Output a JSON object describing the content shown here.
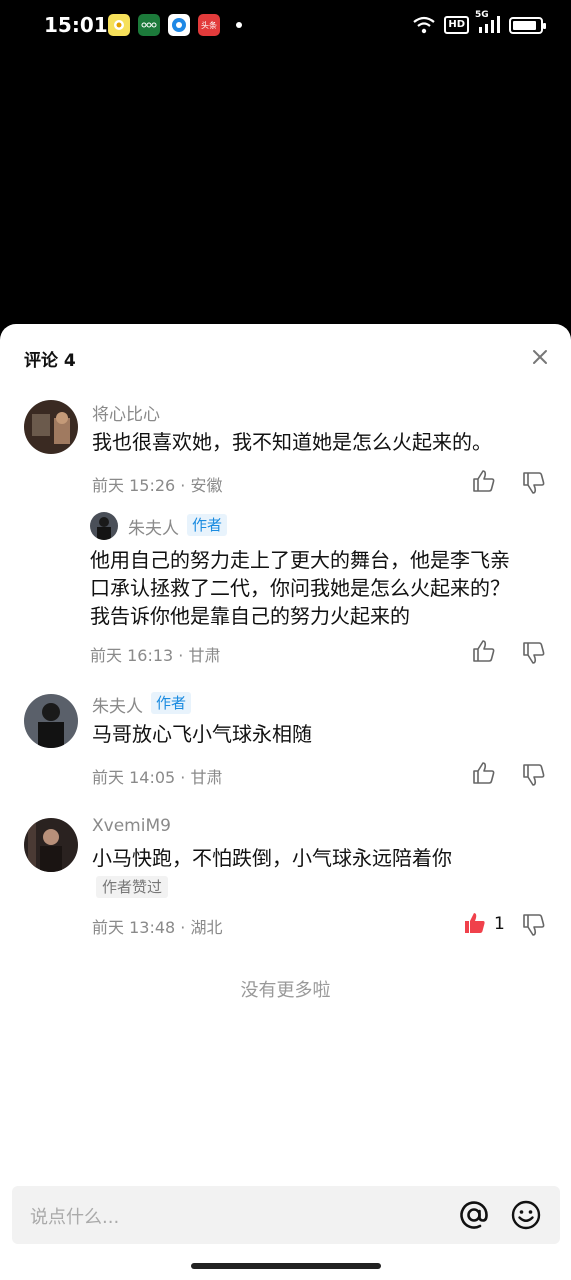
{
  "status_bar": {
    "time": "15:01",
    "app_icons": [
      "notification-app-icon",
      "wechat-pay-icon",
      "browser-icon",
      "toutiao-icon"
    ],
    "toutiao_label": "头条",
    "hd_label": "HD",
    "network_label": "5G",
    "battery_level": 0.9
  },
  "sheet": {
    "title": "评论 4",
    "close_icon": "close-icon"
  },
  "comments": [
    {
      "username": "将心比心",
      "content": "我也很喜欢她，我不知道她是怎么火起来的。",
      "meta": "前天 15:26 · 安徽",
      "reply": {
        "username": "朱夫人",
        "tag": "作者",
        "content_lines": [
          "他用自己的努力走上了更大的舞台，他是李飞亲",
          "口承认拯救了二代，你问我她是怎么火起来的？",
          "我告诉你他是靠自己的努力火起来的"
        ],
        "meta": "前天 16:13 · 甘肃"
      }
    },
    {
      "username": "朱夫人",
      "tag": "作者",
      "content": "马哥放心飞小气球永相随",
      "meta": "前天 14:05 · 甘肃"
    },
    {
      "username": "XvemiM9",
      "content": "小马快跑，不怕跌倒，小气球永远陪着你",
      "badge": "作者赞过",
      "meta": "前天 13:48 · 湖北",
      "like_count": "1",
      "liked": true
    }
  ],
  "footer": {
    "no_more": "没有更多啦",
    "input_placeholder": "说点什么...",
    "at_icon": "at-icon",
    "emoji_icon": "emoji-icon"
  },
  "colors": {
    "author_tag": "#1a8be0",
    "liked": "#f0414b",
    "muted_text": "#8a8a8a"
  }
}
